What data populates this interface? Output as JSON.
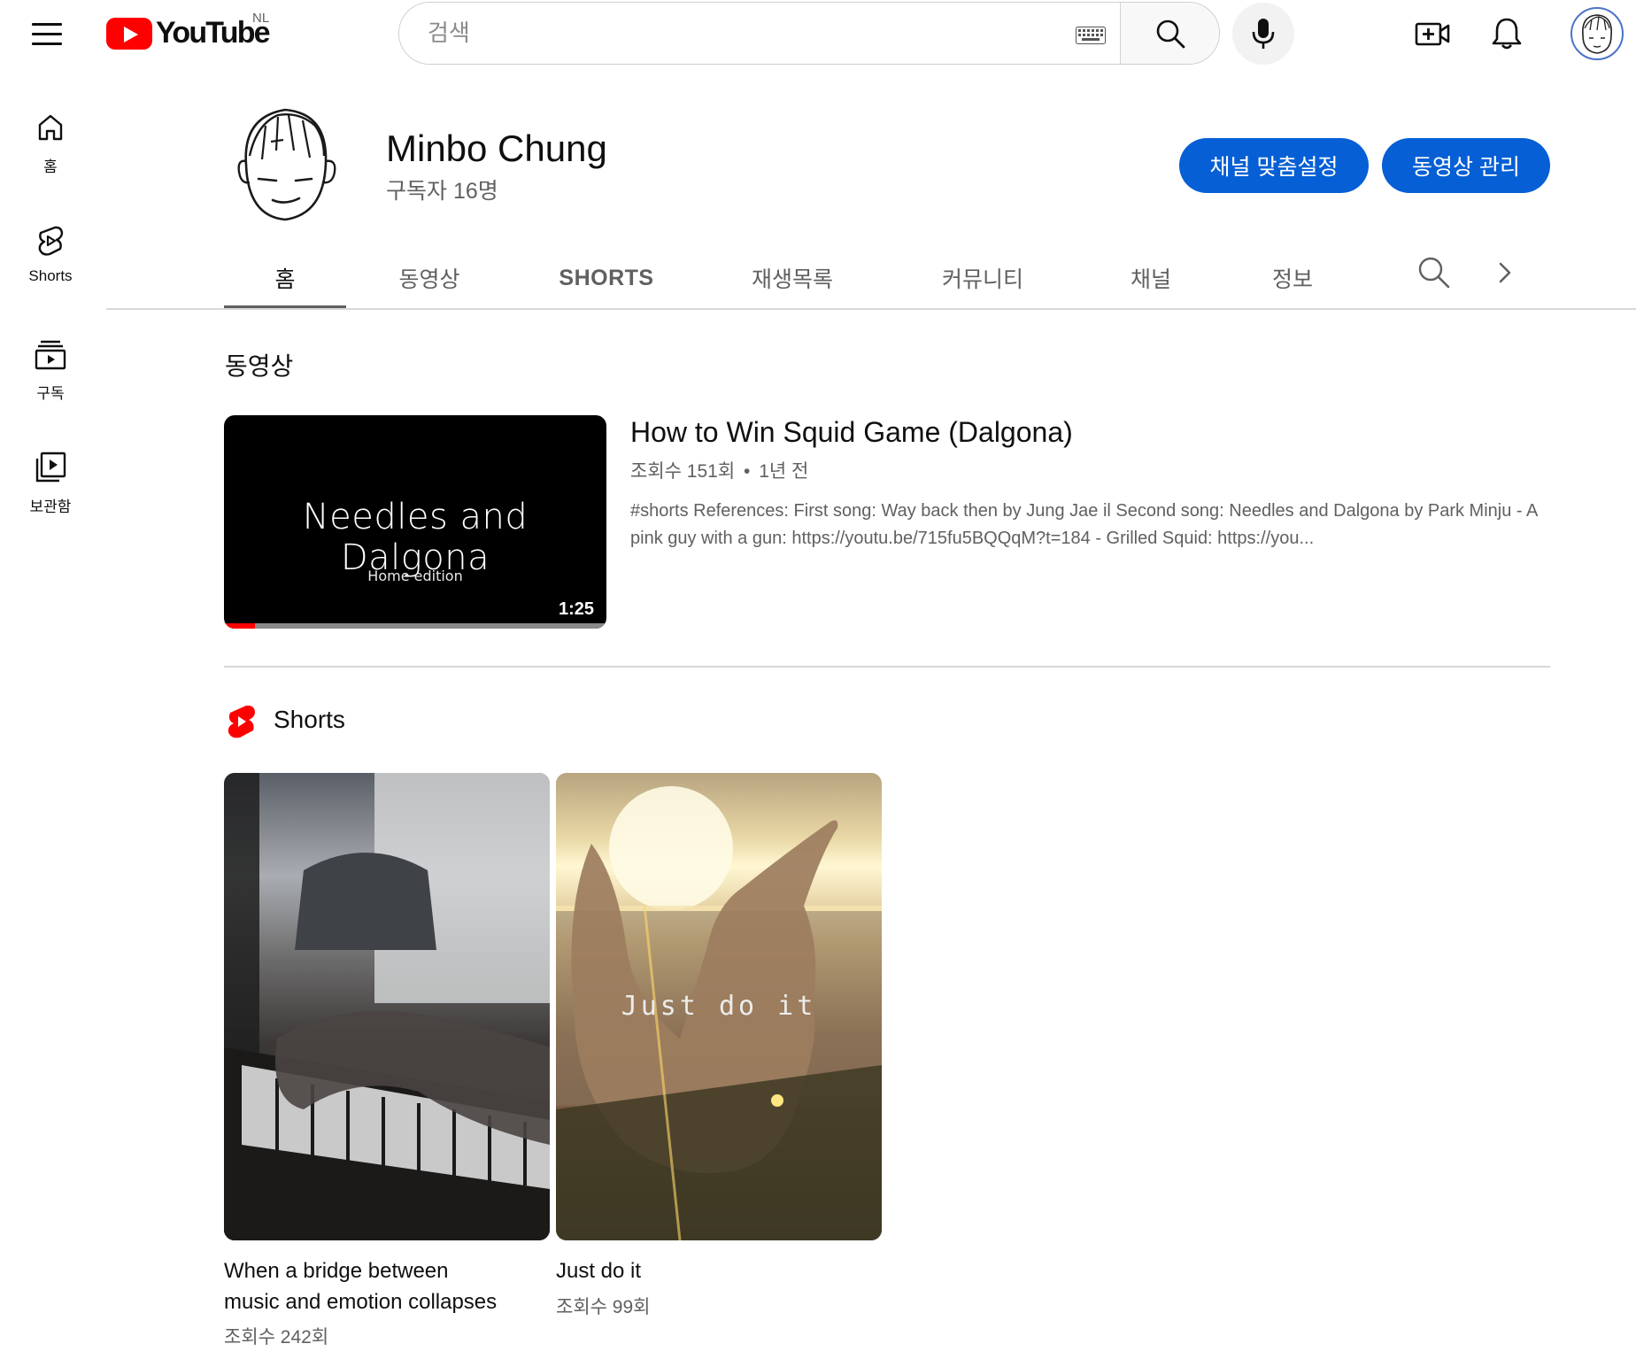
{
  "header": {
    "logo_text": "YouTube",
    "country_code": "NL",
    "search": {
      "placeholder": "검색"
    }
  },
  "sidebar": {
    "items": [
      {
        "label": "홈",
        "icon": "home-icon"
      },
      {
        "label": "Shorts",
        "icon": "shorts-icon"
      },
      {
        "label": "구독",
        "icon": "subscriptions-icon"
      },
      {
        "label": "보관함",
        "icon": "library-icon"
      }
    ]
  },
  "channel": {
    "name": "Minbo Chung",
    "subscribers": "구독자 16명",
    "customize_label": "채널 맞춤설정",
    "manage_label": "동영상 관리"
  },
  "tabs": [
    {
      "label": "홈",
      "active": true
    },
    {
      "label": "동영상"
    },
    {
      "label": "SHORTS"
    },
    {
      "label": "재생목록"
    },
    {
      "label": "커뮤니티"
    },
    {
      "label": "채널"
    },
    {
      "label": "정보"
    }
  ],
  "videos_section": {
    "title": "동영상",
    "featured": {
      "thumbnail_title": "Needles and Dalgona",
      "thumbnail_subtitle": "Home edition",
      "duration": "1:25",
      "watched_fraction": 0.08,
      "title": "How to Win Squid Game (Dalgona)",
      "views": "조회수 151회",
      "separator": "•",
      "age": "1년 전",
      "description": "#shorts References: First song: Way back then by Jung Jae il Second song: Needles and Dalgona by Park Minju - A pink guy with a gun: https://youtu.be/715fu5BQQqM?t=184 - Grilled Squid: https://you..."
    }
  },
  "shorts_section": {
    "title": "Shorts",
    "items": [
      {
        "title_line1": "When a bridge between",
        "title_line2": "music and emotion collapses",
        "views": "조회수 242회",
        "overlay_text": ""
      },
      {
        "title_line1": "Just do it",
        "title_line2": "",
        "views": "조회수 99회",
        "overlay_text": "Just do it"
      }
    ]
  },
  "colors": {
    "brand_red": "#ff0000",
    "primary_button": "#065fd4",
    "secondary_text": "#606060"
  }
}
